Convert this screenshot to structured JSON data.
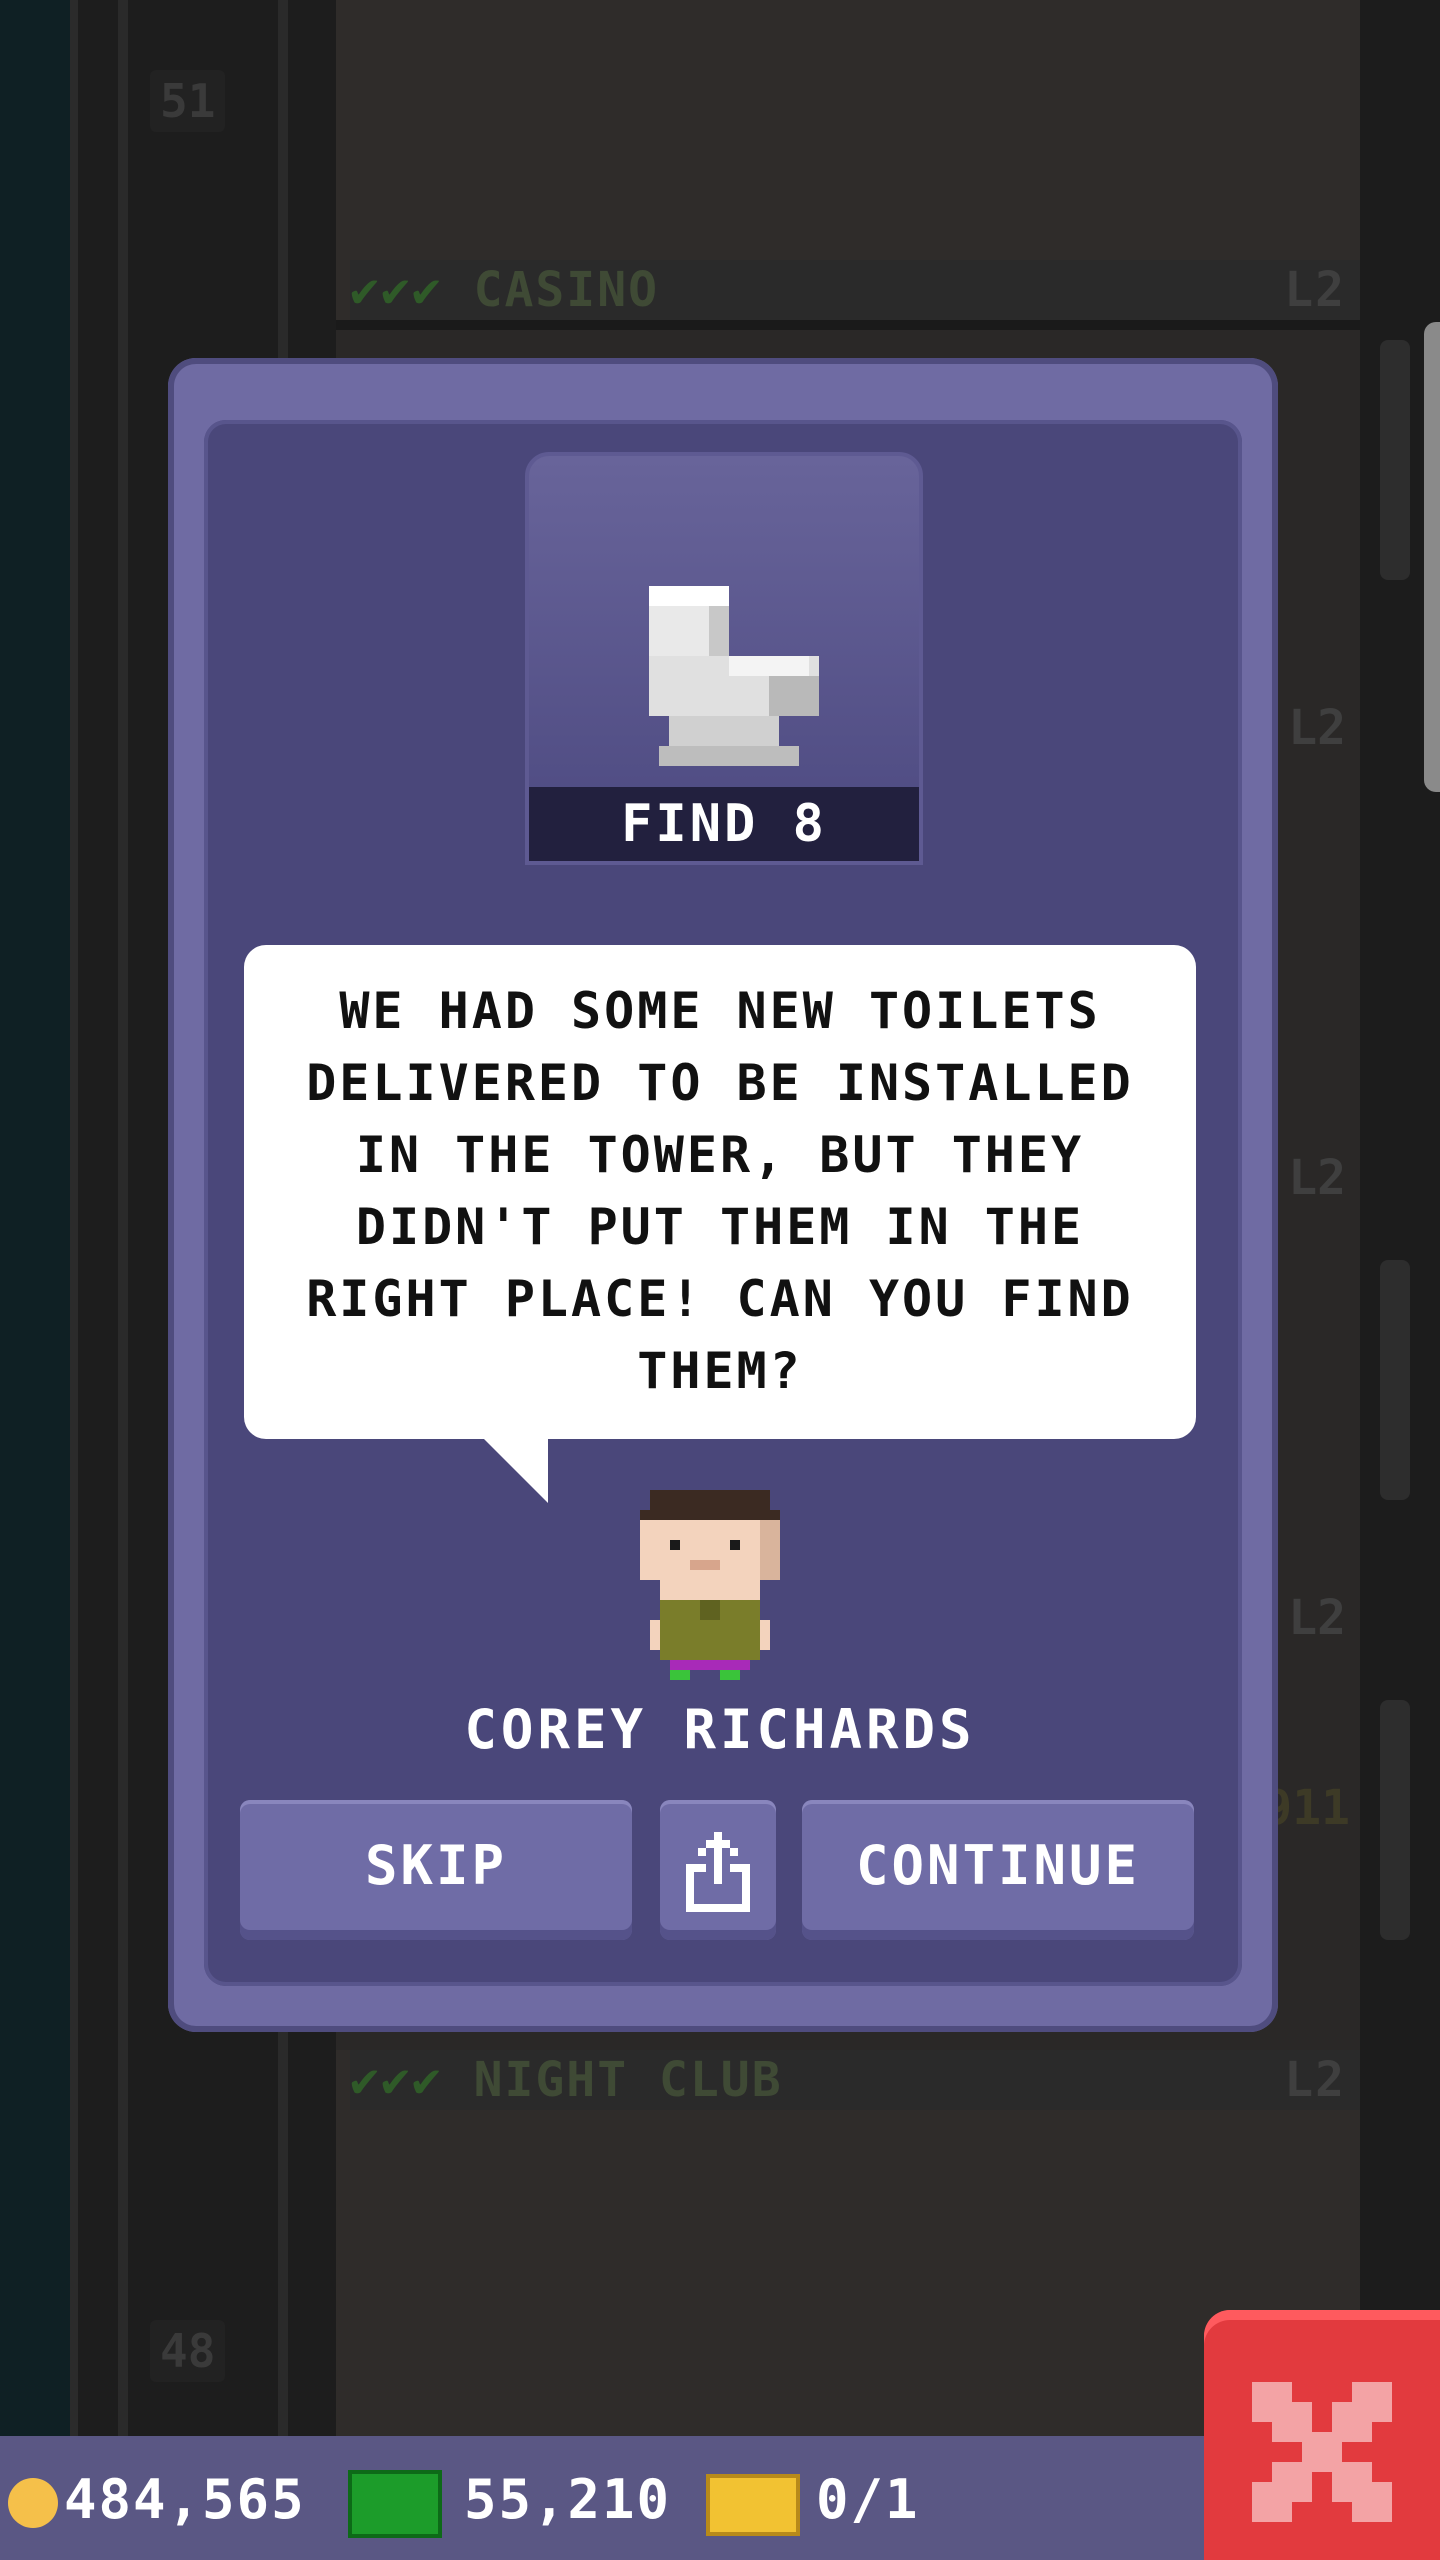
{
  "background": {
    "floor_numbers": [
      "51",
      "48"
    ],
    "rooms": [
      {
        "name": "CASINO",
        "level": "L2"
      },
      {
        "name": "NIGHT CLUB",
        "level": "L2"
      }
    ],
    "side_levels": [
      "L2",
      "L2",
      "L2"
    ],
    "side_number": "911"
  },
  "mission": {
    "goal_label": "FIND 8",
    "item_icon": "toilet-icon",
    "message": "WE HAD SOME NEW TOILETS DELIVERED TO BE INSTALLED IN THE TOWER, BUT THEY DIDN'T PUT THEM IN THE RIGHT PLACE! CAN YOU FIND THEM?",
    "character_name": "COREY RICHARDS"
  },
  "buttons": {
    "skip": "SKIP",
    "share_icon": "share-icon",
    "continue": "CONTINUE"
  },
  "status": {
    "coins": "484,565",
    "bux": "55,210",
    "tickets": "0/1"
  },
  "colors": {
    "dialog": "#6f6ba3",
    "panel": "#4a477a",
    "close": "#e23a3e"
  }
}
